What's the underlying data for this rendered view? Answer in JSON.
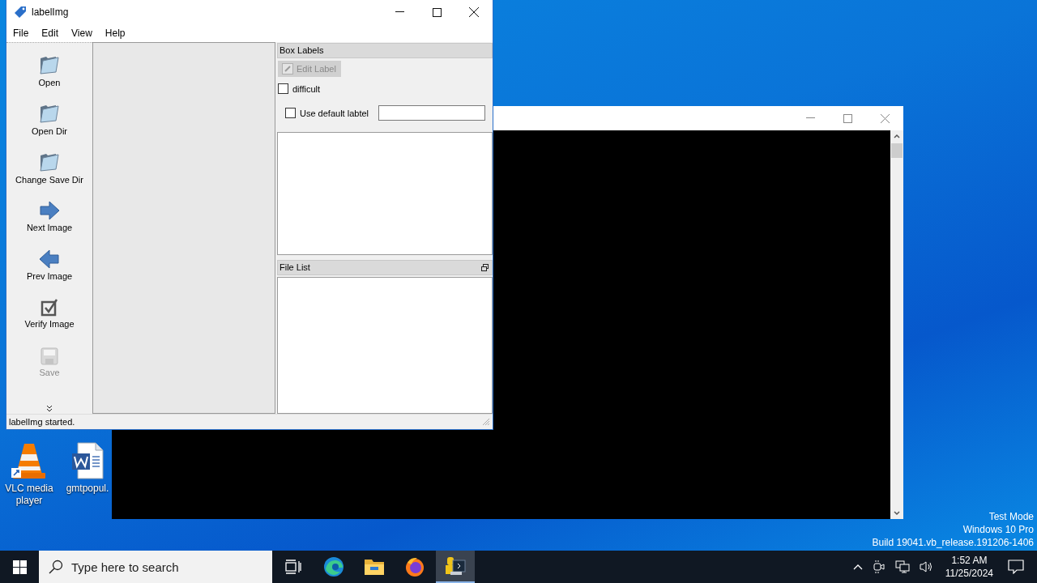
{
  "desktop": {
    "icons": [
      {
        "label": "VLC media player",
        "kind": "vlc"
      },
      {
        "label": "gmtpopul.",
        "kind": "word"
      }
    ],
    "os_notice": [
      "Test Mode",
      "Windows 10 Pro",
      "Build 19041.vb_release.191206-1406"
    ]
  },
  "app_window": {
    "title": "labelImg",
    "menu": [
      "File",
      "Edit",
      "View",
      "Help"
    ],
    "toolbar": [
      {
        "label": "Open",
        "kind": "folder",
        "disabled": false
      },
      {
        "label": "Open Dir",
        "kind": "folder",
        "disabled": false
      },
      {
        "label": "Change Save Dir",
        "kind": "folder",
        "disabled": false
      },
      {
        "label": "Next Image",
        "kind": "next",
        "disabled": false
      },
      {
        "label": "Prev Image",
        "kind": "prev",
        "disabled": false
      },
      {
        "label": "Verify Image",
        "kind": "verify",
        "disabled": false
      },
      {
        "label": "Save",
        "kind": "save",
        "disabled": true
      }
    ],
    "box_labels": {
      "title": "Box Labels",
      "edit_button": {
        "label": "Edit Label",
        "disabled": true
      },
      "difficult": {
        "label": "difficult",
        "checked": false
      },
      "use_default": {
        "label": "Use default labtel",
        "checked": false
      }
    },
    "file_list": {
      "title": "File List"
    },
    "status": "labelImg started."
  },
  "taskbar": {
    "search": {
      "placeholder": "Type here to search"
    },
    "apps": [
      {
        "kind": "edge",
        "selected": false
      },
      {
        "kind": "explorer",
        "selected": false
      },
      {
        "kind": "firefox",
        "selected": false
      },
      {
        "kind": "labelimg",
        "selected": true
      }
    ],
    "clock": {
      "time": "1:52 AM",
      "date": "11/25/2024"
    }
  }
}
